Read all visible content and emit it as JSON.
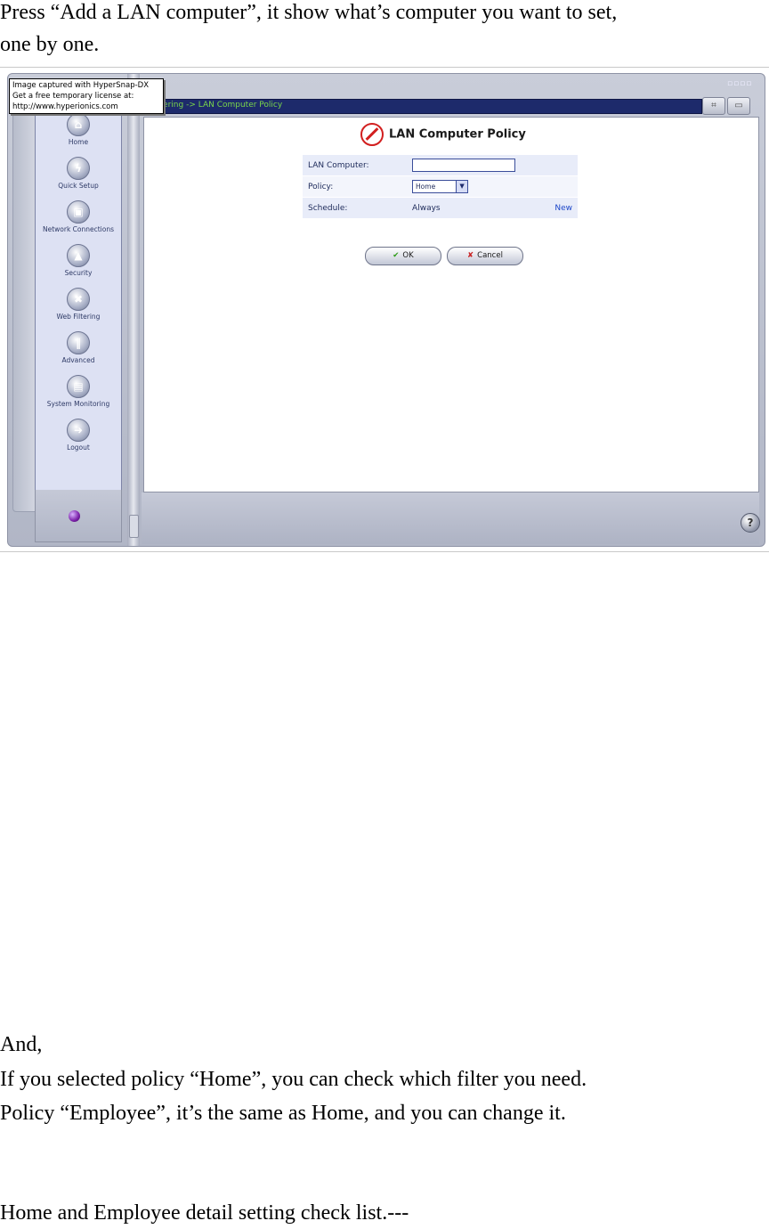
{
  "document": {
    "intro_line1": "Press “Add a LAN computer”, it show what’s computer you want to set,",
    "intro_line2": "one by one.",
    "and_line": "And,",
    "home_line": "If you selected policy “Home”, you can check which filter you need.",
    "employee_line": "Policy “Employee”, it’s the same as Home, and you can change it.",
    "checklist_line": "Home and Employee detail setting check list.---"
  },
  "screenshot": {
    "watermark": {
      "line1": "Image captured with HyperSnap-DX",
      "line2": "Get a free temporary license at:",
      "line3": "http://www.hyperionics.com"
    },
    "breadcrumb": "Filtering -> LAN Computer Policy",
    "nav": [
      {
        "label": "Home",
        "icon": "home-icon"
      },
      {
        "label": "Quick Setup",
        "icon": "lightning-icon"
      },
      {
        "label": "Network Connections",
        "icon": "network-icon"
      },
      {
        "label": "Security",
        "icon": "lock-icon"
      },
      {
        "label": "Web Filtering",
        "icon": "filter-icon"
      },
      {
        "label": "Advanced",
        "icon": "tools-icon"
      },
      {
        "label": "System Monitoring",
        "icon": "monitor-icon"
      },
      {
        "label": "Logout",
        "icon": "logout-icon"
      }
    ],
    "page_title": "LAN Computer Policy",
    "form": {
      "lan_computer_label": "LAN Computer:",
      "lan_computer_value": "",
      "policy_label": "Policy:",
      "policy_value": "Home",
      "schedule_label": "Schedule:",
      "schedule_value": "Always",
      "new_link": "New"
    },
    "ok_label": "OK",
    "cancel_label": "Cancel",
    "help_glyph": "?",
    "colors": {
      "nav_panel": "#dde1f3",
      "topbar": "#1d2a6b",
      "crumb_text": "#7ad64b",
      "no_sign": "#d21f1f"
    }
  }
}
